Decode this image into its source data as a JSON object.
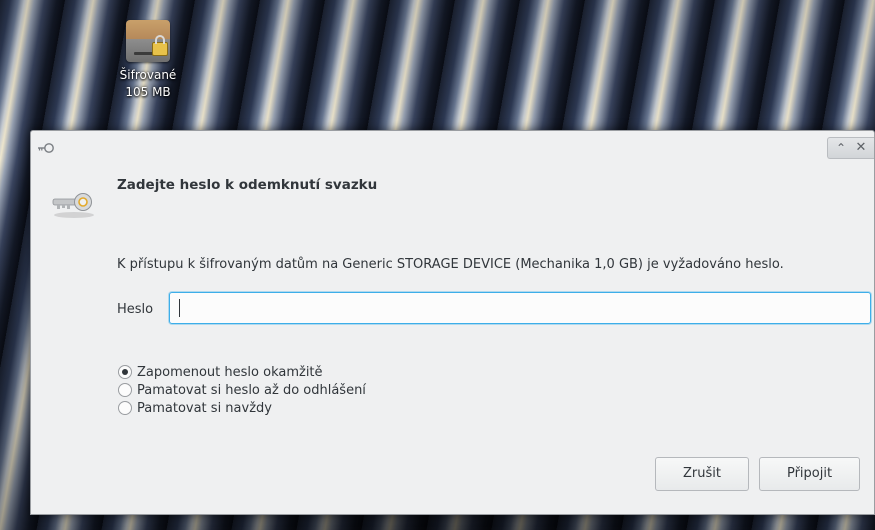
{
  "desktop": {
    "icon_label": "Šifrované",
    "icon_size": "105 MB"
  },
  "dialog": {
    "heading": "Zadejte heslo k odemknutí svazku",
    "message": "K přístupu k šifrovaným datům na Generic STORAGE DEVICE (Mechanika 1,0 GB) je vyžadováno heslo.",
    "password_label": "Heslo",
    "password_value": "",
    "options": [
      {
        "label": "Zapomenout heslo okamžitě",
        "checked": true
      },
      {
        "label": "Pamatovat si heslo až do odhlášení",
        "checked": false
      },
      {
        "label": "Pamatovat si navždy",
        "checked": false
      }
    ],
    "cancel_label": "Zrušit",
    "connect_label": "Připojit",
    "titlebar_buttons": {
      "maximize": "⌃",
      "close": "✕"
    }
  },
  "colors": {
    "focus": "#3daee9",
    "text": "#31363b",
    "window_bg": "#eff0f1"
  }
}
